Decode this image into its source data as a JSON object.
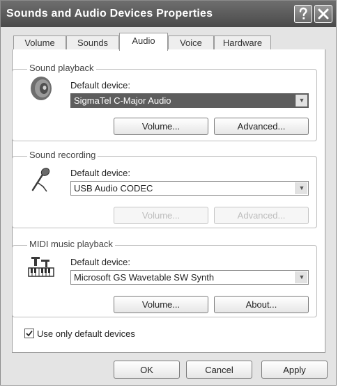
{
  "window": {
    "title": "Sounds and Audio Devices Properties",
    "help_icon": "question-mark-icon",
    "close_icon": "close-x-icon"
  },
  "tabs": [
    {
      "label": "Volume",
      "active": false
    },
    {
      "label": "Sounds",
      "active": false
    },
    {
      "label": "Audio",
      "active": true
    },
    {
      "label": "Voice",
      "active": false
    },
    {
      "label": "Hardware",
      "active": false
    }
  ],
  "playback": {
    "legend": "Sound playback",
    "icon": "speaker-icon",
    "device_label": "Default device:",
    "device_value": "SigmaTel C-Major Audio",
    "volume_button": "Volume...",
    "advanced_button": "Advanced..."
  },
  "recording": {
    "legend": "Sound recording",
    "icon": "microphone-icon",
    "device_label": "Default device:",
    "device_value": "USB Audio CODEC",
    "volume_button": "Volume...",
    "advanced_button": "Advanced..."
  },
  "midi": {
    "legend": "MIDI music playback",
    "icon": "midi-keyboard-icon",
    "device_label": "Default device:",
    "device_value": "Microsoft GS Wavetable SW Synth",
    "volume_button": "Volume...",
    "about_button": "About..."
  },
  "options": {
    "use_default_only_label": "Use only default devices",
    "use_default_only_checked": true
  },
  "dialog_buttons": {
    "ok": "OK",
    "cancel": "Cancel",
    "apply": "Apply"
  }
}
